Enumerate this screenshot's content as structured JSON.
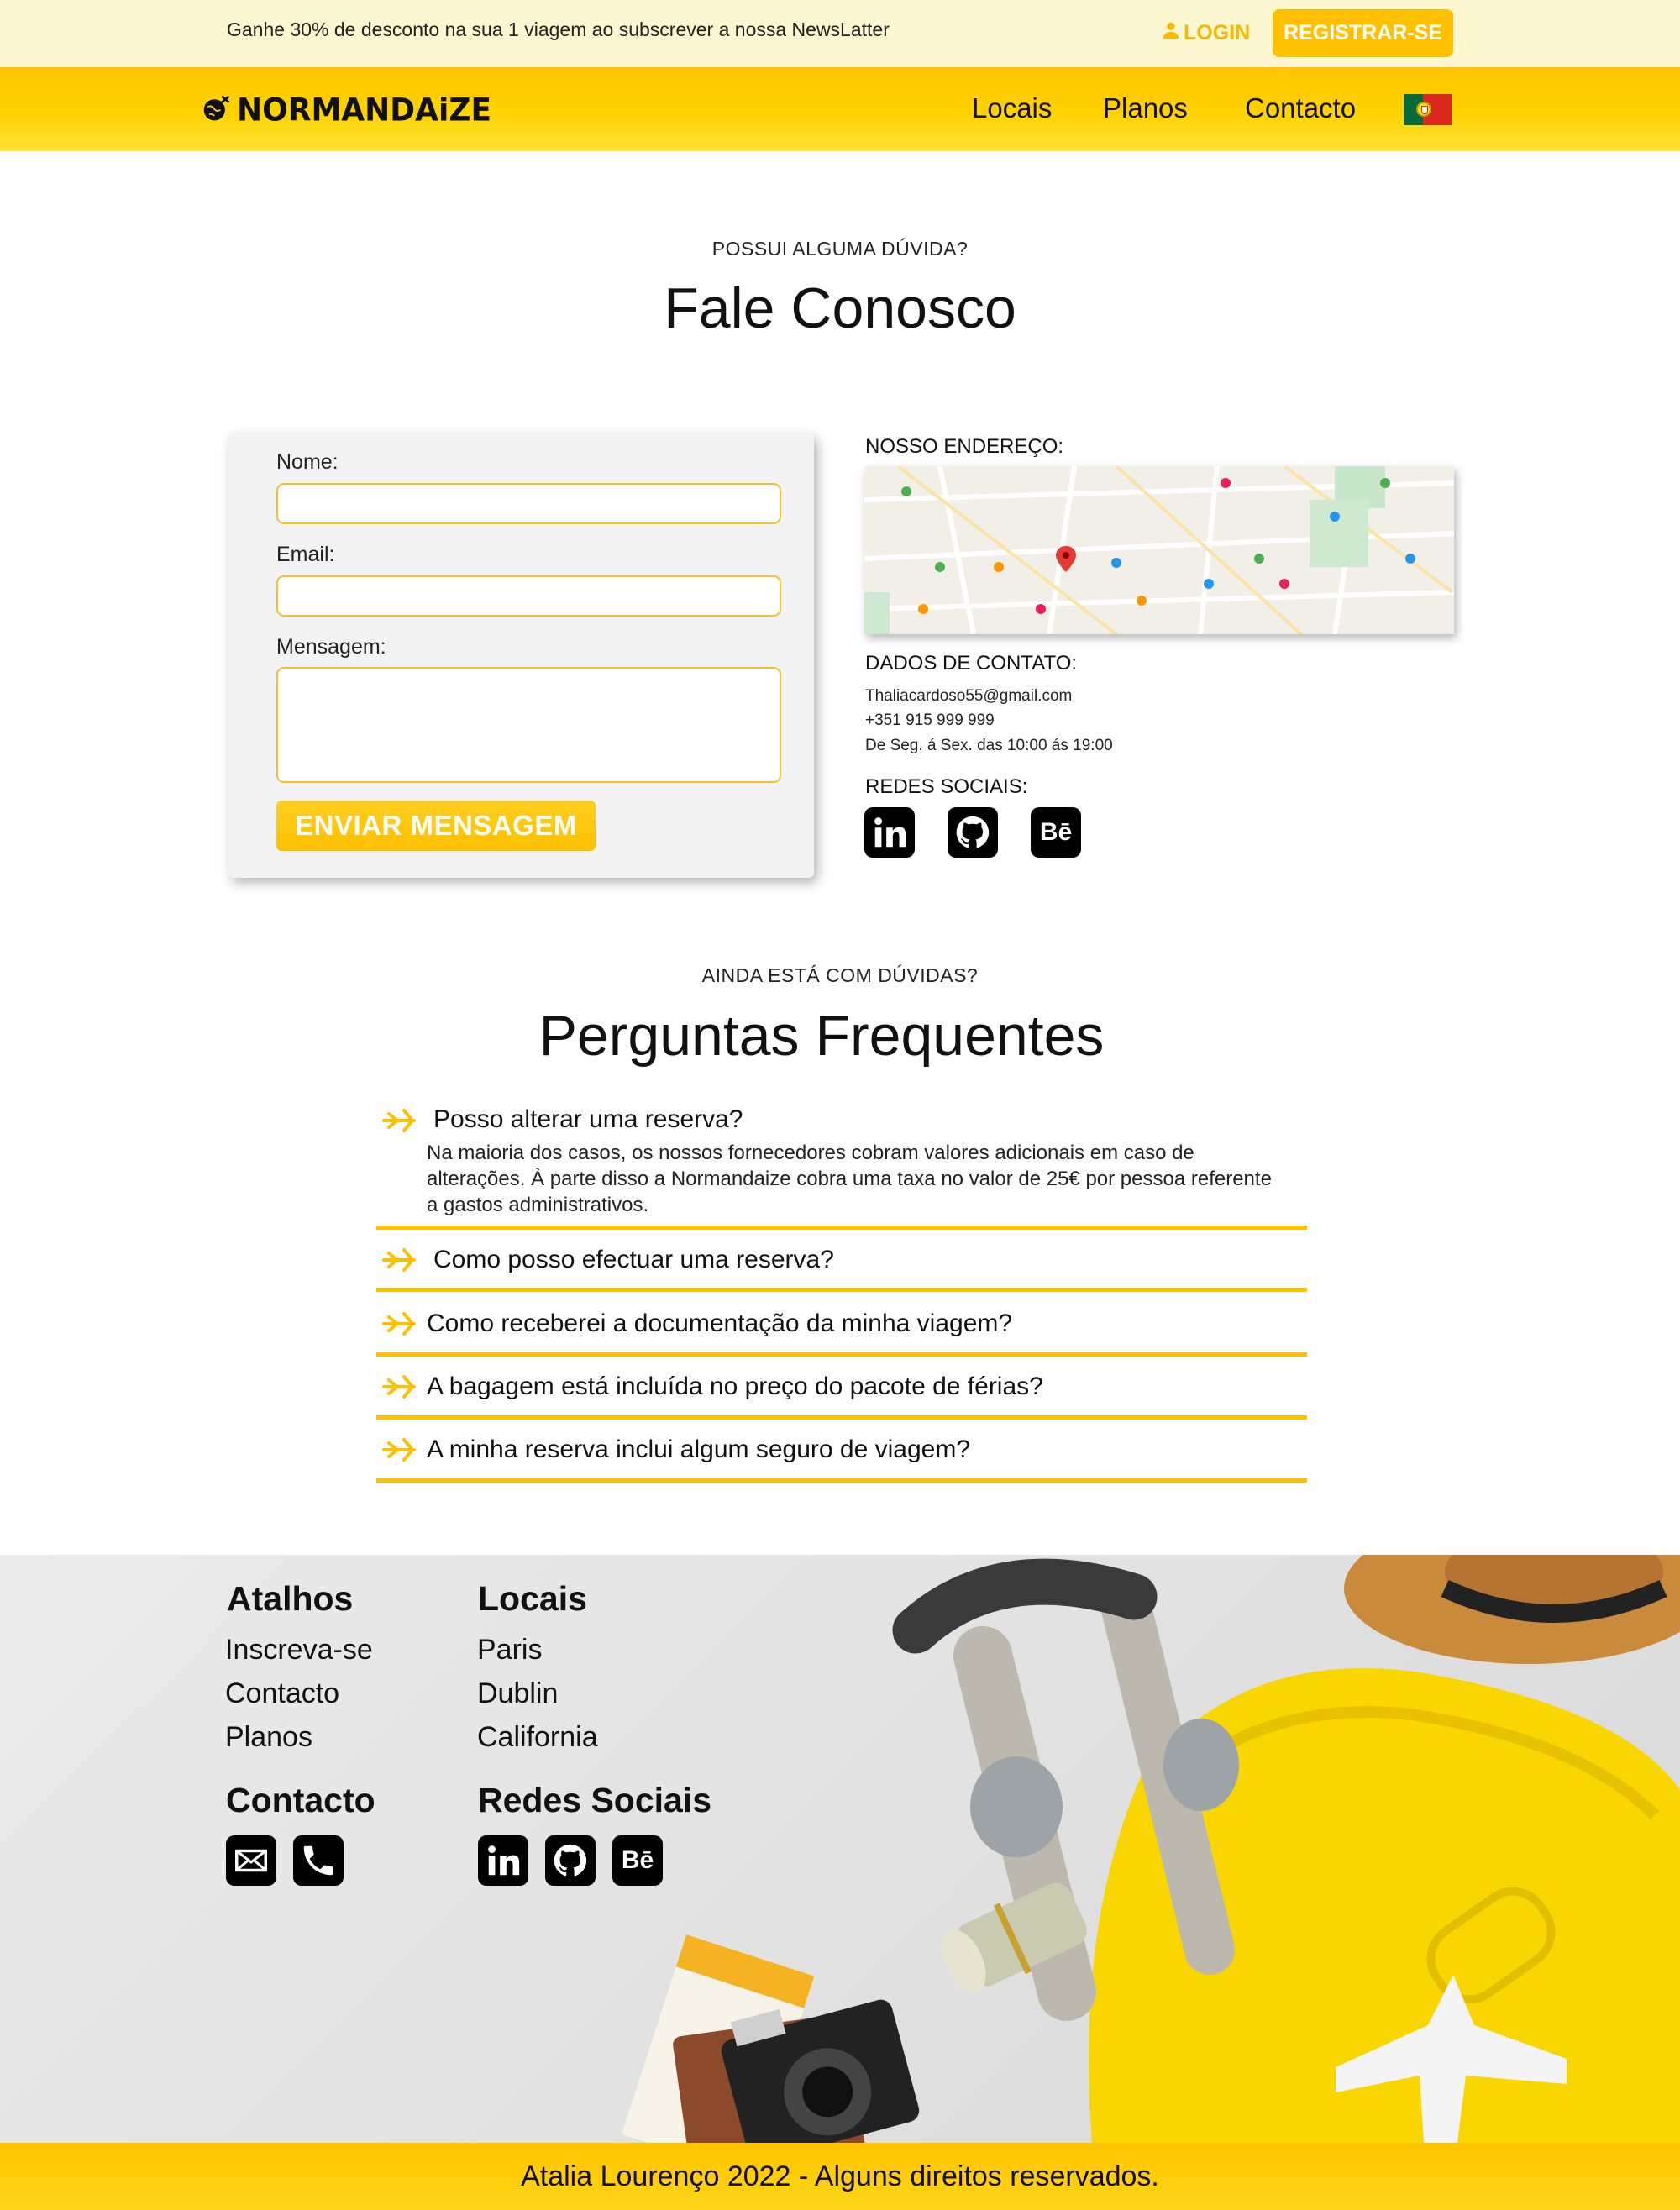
{
  "promo": {
    "text": "Ganhe 30% de desconto na sua 1 viagem ao subscrever a nossa NewsLatter",
    "login_label": "LOGIN",
    "register_label": "REGISTRAR-SE"
  },
  "nav": {
    "logo_text": "NORMANDAiZE",
    "links": [
      "Locais",
      "Planos",
      "Contacto"
    ],
    "flag_icon": "portugal-flag-icon"
  },
  "contact_section": {
    "eyebrow": "POSSUI ALGUMA DÚVIDA?",
    "title": "Fale Conosco",
    "form": {
      "name_label": "Nome:",
      "name_value": "",
      "email_label": "Email:",
      "email_value": "",
      "message_label": "Mensagem:",
      "message_value": "",
      "submit_label": "ENVIAR MENSAGEM"
    },
    "address_label": "NOSSO ENDEREÇO:",
    "contact_label": "DADOS DE CONTATO:",
    "contact_lines": [
      "Thaliacardoso55@gmail.com",
      "+351 915 999 999",
      "De Seg. á Sex. das 10:00 ás 19:00"
    ],
    "social_label": "REDES SOCIAIS:",
    "social_icons": [
      "linkedin-icon",
      "github-icon",
      "behance-icon"
    ]
  },
  "faq": {
    "eyebrow": "AINDA ESTÁ COM DÚVIDAS?",
    "title": "Perguntas Frequentes",
    "items": [
      {
        "question": "Posso alterar uma reserva?",
        "answer": "Na maioria dos casos, os nossos fornecedores cobram valores adicionais em caso de alterações. À parte disso a Normandaize cobra uma taxa no valor de 25€ por pessoa referente a gastos administrativos."
      },
      {
        "question": "Como posso efectuar uma reserva?"
      },
      {
        "question": "Como receberei a documentação da minha viagem?"
      },
      {
        "question": "A bagagem está incluída no preço do pacote de férias?"
      },
      {
        "question": "A minha reserva inclui algum seguro de viagem?"
      }
    ],
    "accent_color": "#ffc000"
  },
  "footer": {
    "shortcuts_title": "Atalhos",
    "shortcuts": [
      "Inscreva-se",
      "Contacto",
      "Planos"
    ],
    "places_title": "Locais",
    "places": [
      "Paris",
      "Dublin",
      "California"
    ],
    "contact_title": "Contacto",
    "contact_icons": [
      "mail-icon",
      "phone-icon"
    ],
    "social_title": "Redes Sociais",
    "social_icons": [
      "linkedin-icon",
      "github-icon",
      "behance-icon"
    ],
    "copyright": "Atalia Lourenço 2022 - Alguns direitos reservados."
  },
  "colors": {
    "brand_yellow": "#ffc000",
    "promo_bg": "#fdf7d1",
    "text": "#111111"
  }
}
